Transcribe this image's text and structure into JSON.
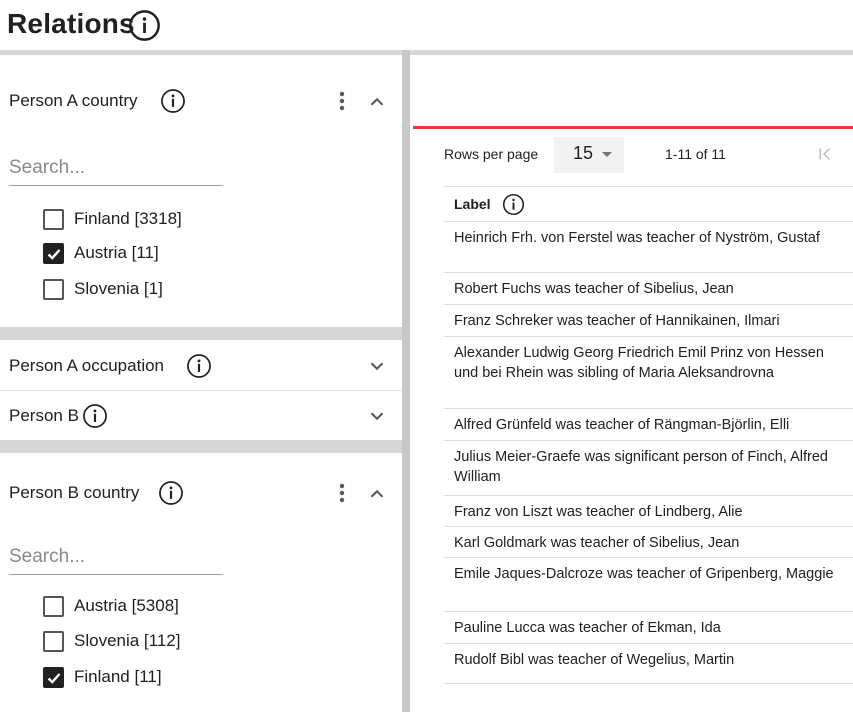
{
  "page": {
    "title": "Relations"
  },
  "filters": {
    "person_a_country": {
      "title": "Person A country",
      "search_placeholder": "Search...",
      "options": [
        {
          "label": "Finland [3318]",
          "checked": false
        },
        {
          "label": "Austria [11]",
          "checked": true
        },
        {
          "label": "Slovenia [1]",
          "checked": false
        }
      ]
    },
    "person_a_occupation": {
      "title": "Person A occupation"
    },
    "person_b": {
      "title": "Person B"
    },
    "person_b_country": {
      "title": "Person B country",
      "search_placeholder": "Search...",
      "options": [
        {
          "label": "Austria [5308]",
          "checked": false
        },
        {
          "label": "Slovenia [112]",
          "checked": false
        },
        {
          "label": "Finland [11]",
          "checked": true
        }
      ]
    }
  },
  "table": {
    "rows_per_page_label": "Rows per page",
    "rows_per_page_value": "15",
    "range_label": "1-11 of 11",
    "column_header": "Label",
    "rows": [
      "Heinrich Frh. von Ferstel was teacher of Nyström, Gustaf",
      "Robert Fuchs was teacher of Sibelius, Jean",
      "Franz Schreker was teacher of Hannikainen, Ilmari",
      "Alexander Ludwig Georg Friedrich Emil Prinz von Hessen und bei Rhein was sibling of Maria Aleksandrovna",
      "Alfred Grünfeld was teacher of Rängman-Björlin, Elli",
      "Julius Meier-Graefe was significant person of Finch, Alfred William",
      "Franz von Liszt was teacher of Lindberg, Alie",
      "Karl Goldmark was teacher of Sibelius, Jean",
      "Emile Jaques-Dalcroze was teacher of Gripenberg, Maggie",
      "Pauline Lucca was teacher of Ekman, Ida",
      "Rudolf Bibl was teacher of Wegelius, Martin"
    ]
  },
  "colors": {
    "accent_line": "#e53935",
    "divider": "#e0e0e0",
    "panel_gap": "#d6d6d6"
  },
  "icons": [
    "info-icon",
    "more-vert-icon",
    "chevron-up-icon",
    "chevron-down-icon",
    "check-icon",
    "first-page-icon"
  ]
}
